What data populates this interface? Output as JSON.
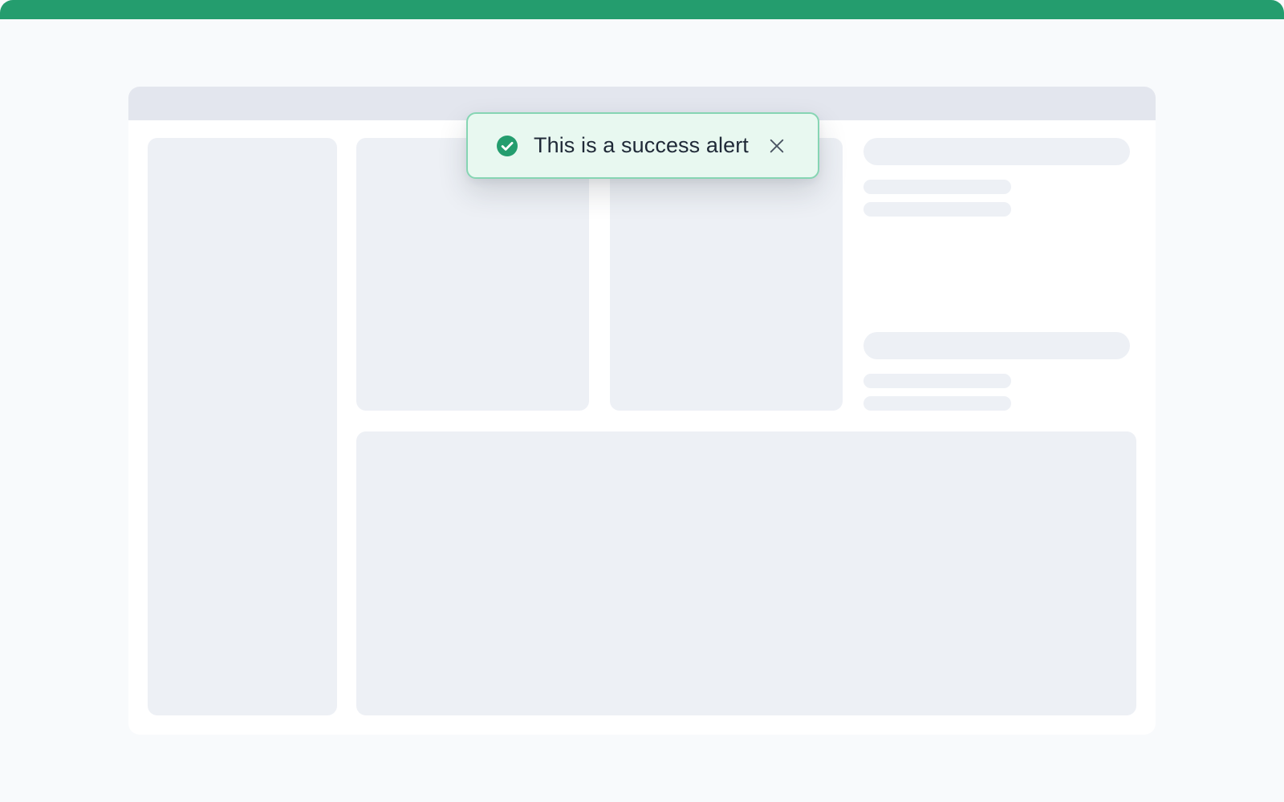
{
  "alert": {
    "type": "success",
    "message": "This is a success alert",
    "icon": "check-circle-icon",
    "close_icon": "close-icon"
  },
  "colors": {
    "accent_green": "#249d6e",
    "alert_background": "#e8f8f0",
    "alert_border": "#86d5b3",
    "alert_text": "#1f2937",
    "page_background": "#f8fafc",
    "window_background": "#ffffff",
    "header_background": "#e3e6ee",
    "skeleton_fill": "#edf0f5",
    "close_icon_color": "#4b5563"
  }
}
